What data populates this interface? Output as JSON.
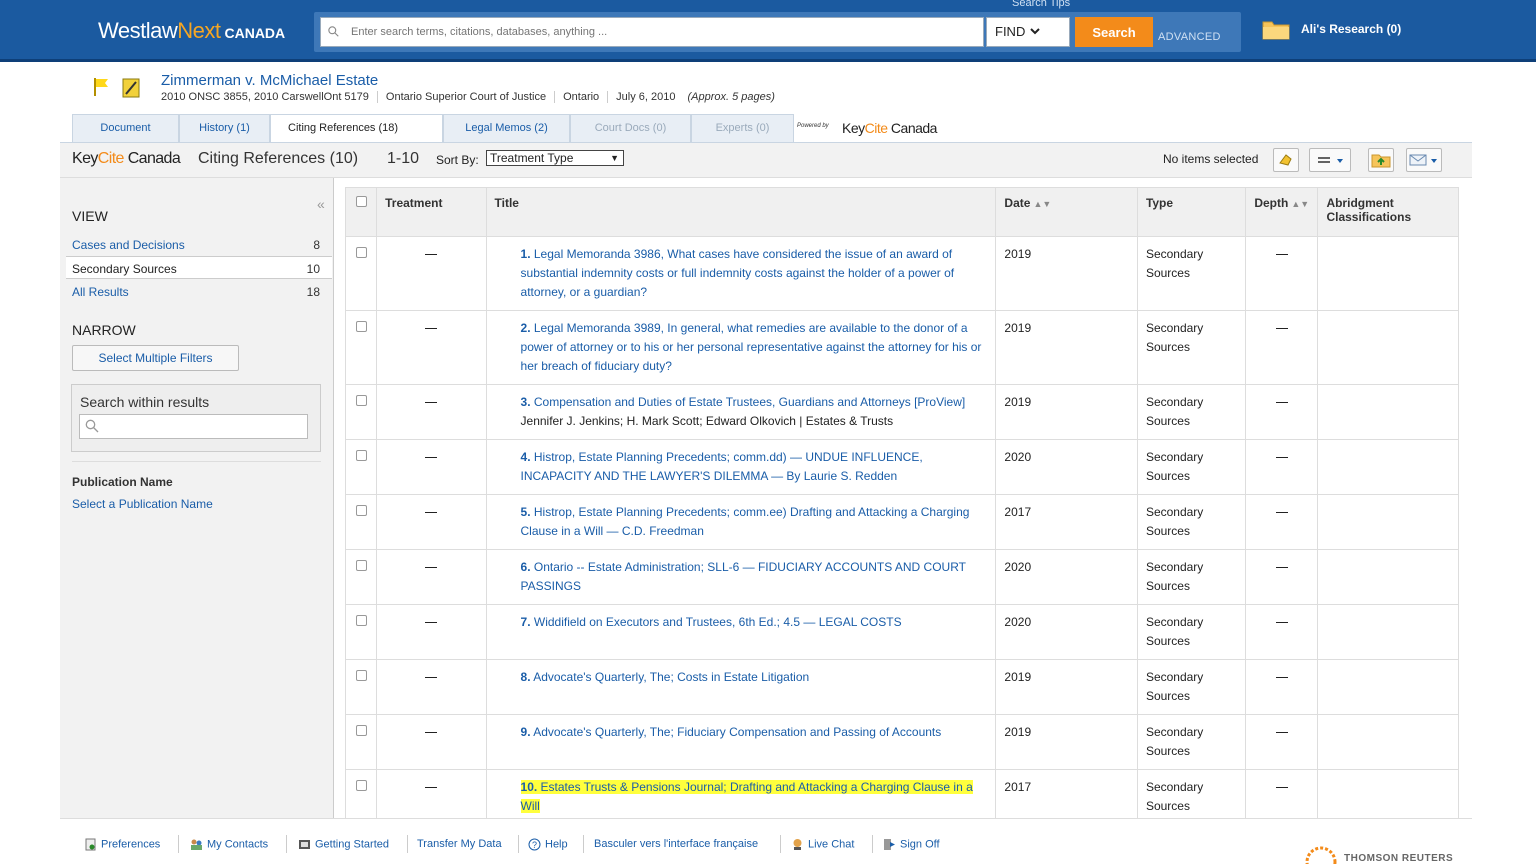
{
  "header": {
    "logo_main": "Westlaw",
    "logo_next": "Next",
    "logo_region": "CANADA",
    "search_tips": "Search Tips",
    "search_placeholder": "Enter search terms, citations, databases, anything ...",
    "find_label": "FIND",
    "search_button": "Search",
    "advanced_link": "ADVANCED",
    "research_folder": "Ali's Research (0)"
  },
  "document": {
    "title": "Zimmerman v. McMichael Estate",
    "citation": "2010 ONSC 3855, 2010 CarswellOnt 5179",
    "court": "Ontario Superior Court of Justice",
    "jurisdiction": "Ontario",
    "date": "July 6, 2010",
    "length": "(Approx. 5 pages)"
  },
  "tabs": [
    {
      "label": "Document"
    },
    {
      "label": "History (1)"
    },
    {
      "label": "Citing References (18)"
    },
    {
      "label": "Legal Memos (2)"
    },
    {
      "label": "Court Docs (0)"
    },
    {
      "label": "Experts (0)"
    }
  ],
  "powered_by": "Powered by",
  "keycite_brand": {
    "key": "Key",
    "cite": "Cite",
    "canada": " Canada"
  },
  "toolbar": {
    "section_title": "Citing References (10)",
    "range": "1-10",
    "sort_label": "Sort By:",
    "sort_value": "Treatment Type",
    "selection_status": "No items selected"
  },
  "sidebar": {
    "view_heading": "VIEW",
    "view_items": [
      {
        "label": "Cases and Decisions",
        "count": "8"
      },
      {
        "label": "Secondary Sources",
        "count": "10"
      },
      {
        "label": "All Results",
        "count": "18"
      }
    ],
    "narrow_heading": "NARROW",
    "filters_button": "Select Multiple Filters",
    "search_within_label": "Search within results",
    "pub_heading": "Publication Name",
    "pub_link": "Select a Publication Name"
  },
  "table": {
    "headers": {
      "treatment": "Treatment",
      "title": "Title",
      "date": "Date",
      "type": "Type",
      "depth": "Depth",
      "abridgment": "Abridgment Classifications"
    },
    "rows": [
      {
        "num": "1.",
        "title": "Legal Memoranda 3986, What cases have considered the issue of an award of substantial indemnity costs or full indemnity costs against the holder of a power of attorney, or a guardian?",
        "sub": "",
        "date": "2019",
        "type": "Secondary Sources"
      },
      {
        "num": "2.",
        "title": "Legal Memoranda 3989, In general, what remedies are available to the donor of a power of attorney or to his or her personal representative against the attorney for his or her breach of fiduciary duty?",
        "sub": "",
        "date": "2019",
        "type": "Secondary Sources"
      },
      {
        "num": "3.",
        "title": "Compensation and Duties of Estate Trustees, Guardians and Attorneys [ProView]",
        "sub": "Jennifer J. Jenkins; H. Mark Scott; Edward Olkovich | Estates & Trusts",
        "date": "2019",
        "type": "Secondary Sources"
      },
      {
        "num": "4.",
        "title": "Histrop, Estate Planning Precedents; comm.dd) — UNDUE INFLUENCE, INCAPACITY AND THE LAWYER'S DILEMMA — By Laurie S. Redden",
        "sub": "",
        "date": "2020",
        "type": "Secondary Sources"
      },
      {
        "num": "5.",
        "title": "Histrop, Estate Planning Precedents; comm.ee) Drafting and Attacking a Charging Clause in a Will — C.D. Freedman",
        "sub": "",
        "date": "2017",
        "type": "Secondary Sources"
      },
      {
        "num": "6.",
        "title": "Ontario -- Estate Administration; SLL-6 — FIDUCIARY ACCOUNTS AND COURT PASSINGS",
        "sub": "",
        "date": "2020",
        "type": "Secondary Sources"
      },
      {
        "num": "7.",
        "title": "Widdifield on Executors and Trustees, 6th Ed.; 4.5 — LEGAL COSTS",
        "sub": "",
        "date": "2020",
        "type": "Secondary Sources"
      },
      {
        "num": "8.",
        "title": "Advocate's Quarterly, The; Costs in Estate Litigation",
        "sub": "",
        "date": "2019",
        "type": "Secondary Sources"
      },
      {
        "num": "9.",
        "title": "Advocate's Quarterly, The; Fiduciary Compensation and Passing of Accounts",
        "sub": "",
        "date": "2019",
        "type": "Secondary Sources"
      },
      {
        "num": "10.",
        "title": "Estates Trusts & Pensions Journal; Drafting and Attacking a Charging Clause in a Will",
        "sub": "",
        "date": "2017",
        "type": "Secondary Sources",
        "highlight": true
      }
    ]
  },
  "footer": {
    "items": [
      "Preferences",
      "My Contacts",
      "Getting Started",
      "Transfer My Data",
      "Help",
      "Basculer vers l'interface française",
      "Live Chat",
      "Sign Off"
    ],
    "brand": "THOMSON REUTERS"
  },
  "colors": {
    "header_blue": "#1b5aa0",
    "search_orange": "#f38b1a",
    "link_blue": "#1a5da8",
    "highlight_yellow": "#ffff3d"
  }
}
